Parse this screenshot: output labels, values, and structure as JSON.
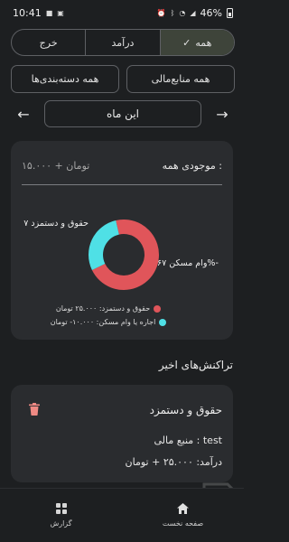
{
  "status_bar": {
    "time": "10:41",
    "battery": "46%"
  },
  "tabs": [
    {
      "label": "همه",
      "active": true,
      "icon": "check-icon"
    },
    {
      "label": "درآمد",
      "active": false
    },
    {
      "label": "خرج",
      "active": false
    }
  ],
  "filters": {
    "all_sources": "همه منابع‌مالی",
    "all_categories": "همه دسته‌بندی‌ها"
  },
  "period": {
    "label": "این ماه"
  },
  "summary": {
    "balance_label": "موجودی همه :",
    "balance_value": "۱۵.۰۰۰ + تومان"
  },
  "chart_data": {
    "type": "pie",
    "categories": [
      "حقوق و دستمزد",
      "اجاره یا وام مسکن"
    ],
    "values": [
      25000,
      -10000
    ],
    "slice_labels": [
      "حقوق و دستمزد ۷",
      "وام مسکن ۶۷%-"
    ],
    "colors": [
      "#e0555a",
      "#4fe0e6"
    ],
    "legend": [
      "حقوق و دستمزد: ۲۵.۰۰۰ تومان",
      "اجاره یا وام مسکن: ۱۰.۰۰۰- تومان"
    ],
    "legend_position": "bottom"
  },
  "recent": {
    "title": "تراکنش‌های اخیر",
    "transaction": {
      "title": "حقوق و دستمزد",
      "source": "منبع مالی : test",
      "amount": "درآمد: ۲۵.۰۰۰ + تومان"
    }
  },
  "nav": {
    "report": "گزارش",
    "home": "صفحه نخست"
  }
}
